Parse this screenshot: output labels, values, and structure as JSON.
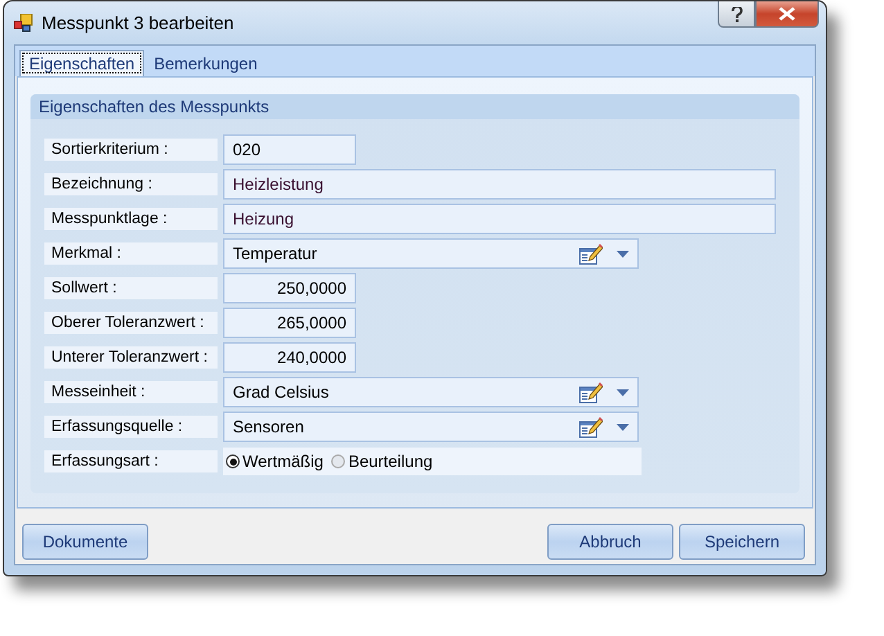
{
  "window": {
    "title": "Messpunkt 3 bearbeiten"
  },
  "tabs": [
    {
      "label": "Eigenschaften",
      "selected": true
    },
    {
      "label": "Bemerkungen",
      "selected": false
    }
  ],
  "group": {
    "title": "Eigenschaften des Messpunkts"
  },
  "fields": [
    {
      "kind": "short",
      "label": "Sortierkriterium :",
      "value": "020"
    },
    {
      "kind": "wide",
      "label": "Bezeichnung :",
      "value": "Heizleistung"
    },
    {
      "kind": "wide",
      "label": "Messpunktlage :",
      "value": "Heizung"
    },
    {
      "kind": "combo",
      "label": "Merkmal :",
      "value": "Temperatur"
    },
    {
      "kind": "number",
      "label": "Sollwert :",
      "value": "250,0000"
    },
    {
      "kind": "number",
      "label": "Oberer Toleranzwert :",
      "value": "265,0000"
    },
    {
      "kind": "number",
      "label": "Unterer Toleranzwert :",
      "value": "240,0000"
    },
    {
      "kind": "combo",
      "label": "Messeinheit :",
      "value": "Grad Celsius"
    },
    {
      "kind": "combo",
      "label": "Erfassungsquelle :",
      "value": "Sensoren"
    },
    {
      "kind": "radio",
      "label": "Erfassungsart :",
      "options": [
        {
          "label": "Wertmäßig",
          "selected": true
        },
        {
          "label": "Beurteilung",
          "selected": false
        }
      ]
    }
  ],
  "buttons_left": [
    "Dokumente"
  ],
  "buttons_right": [
    "Abbruch",
    "Speichern"
  ]
}
